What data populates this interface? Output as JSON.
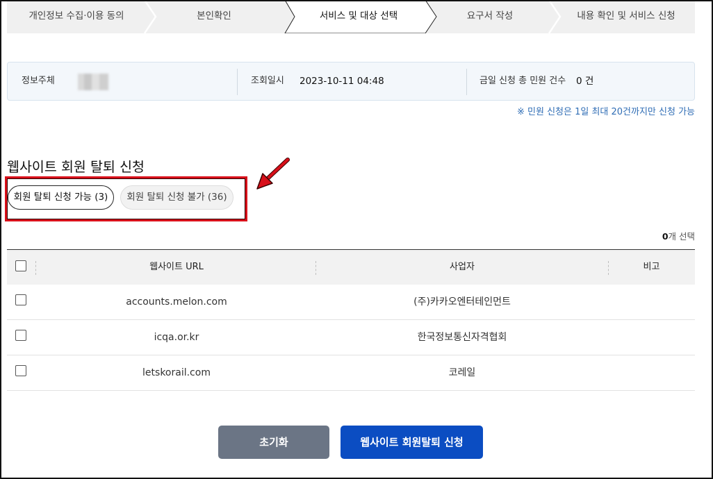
{
  "stepper": {
    "steps": [
      {
        "label": "개인정보 수집·이용 동의",
        "active": false
      },
      {
        "label": "본인확인",
        "active": false
      },
      {
        "label": "서비스 및 대상 선택",
        "active": true
      },
      {
        "label": "요구서 작성",
        "active": false
      },
      {
        "label": "내용 확인 및 서비스 신청",
        "active": false
      }
    ]
  },
  "info": {
    "subject_label": "정보주체",
    "query_time_label": "조회일시",
    "query_time_value": "2023-10-11 04:48",
    "today_count_label": "금일 신청 총 민원 건수",
    "today_count_value": "0 건",
    "notice": "※ 민원 신청은 1일 최대 20건까지만 신청 가능"
  },
  "section": {
    "title": "웹사이트 회원 탈퇴 신청",
    "chips": [
      {
        "label": "회원 탈퇴 신청 가능 (3)",
        "selected": true
      },
      {
        "label": "회원 탈퇴 신청 불가 (36)",
        "selected": false
      }
    ],
    "selected_count": "0",
    "selected_suffix": "개 선택"
  },
  "table": {
    "headers": {
      "url": "웹사이트 URL",
      "company": "사업자",
      "note": "비고"
    },
    "rows": [
      {
        "url": "accounts.melon.com",
        "company": "(주)카카오엔터테인먼트",
        "note": ""
      },
      {
        "url": "icqa.or.kr",
        "company": "한국정보통신자격협회",
        "note": ""
      },
      {
        "url": "letskorail.com",
        "company": "코레일",
        "note": ""
      }
    ]
  },
  "buttons": {
    "reset": "초기화",
    "submit": "웹사이트 회원탈퇴 신청"
  },
  "colors": {
    "primary": "#0b4dc2",
    "secondary_button": "#6b7585",
    "highlight": "#d8101a",
    "notice": "#2f6db5"
  }
}
